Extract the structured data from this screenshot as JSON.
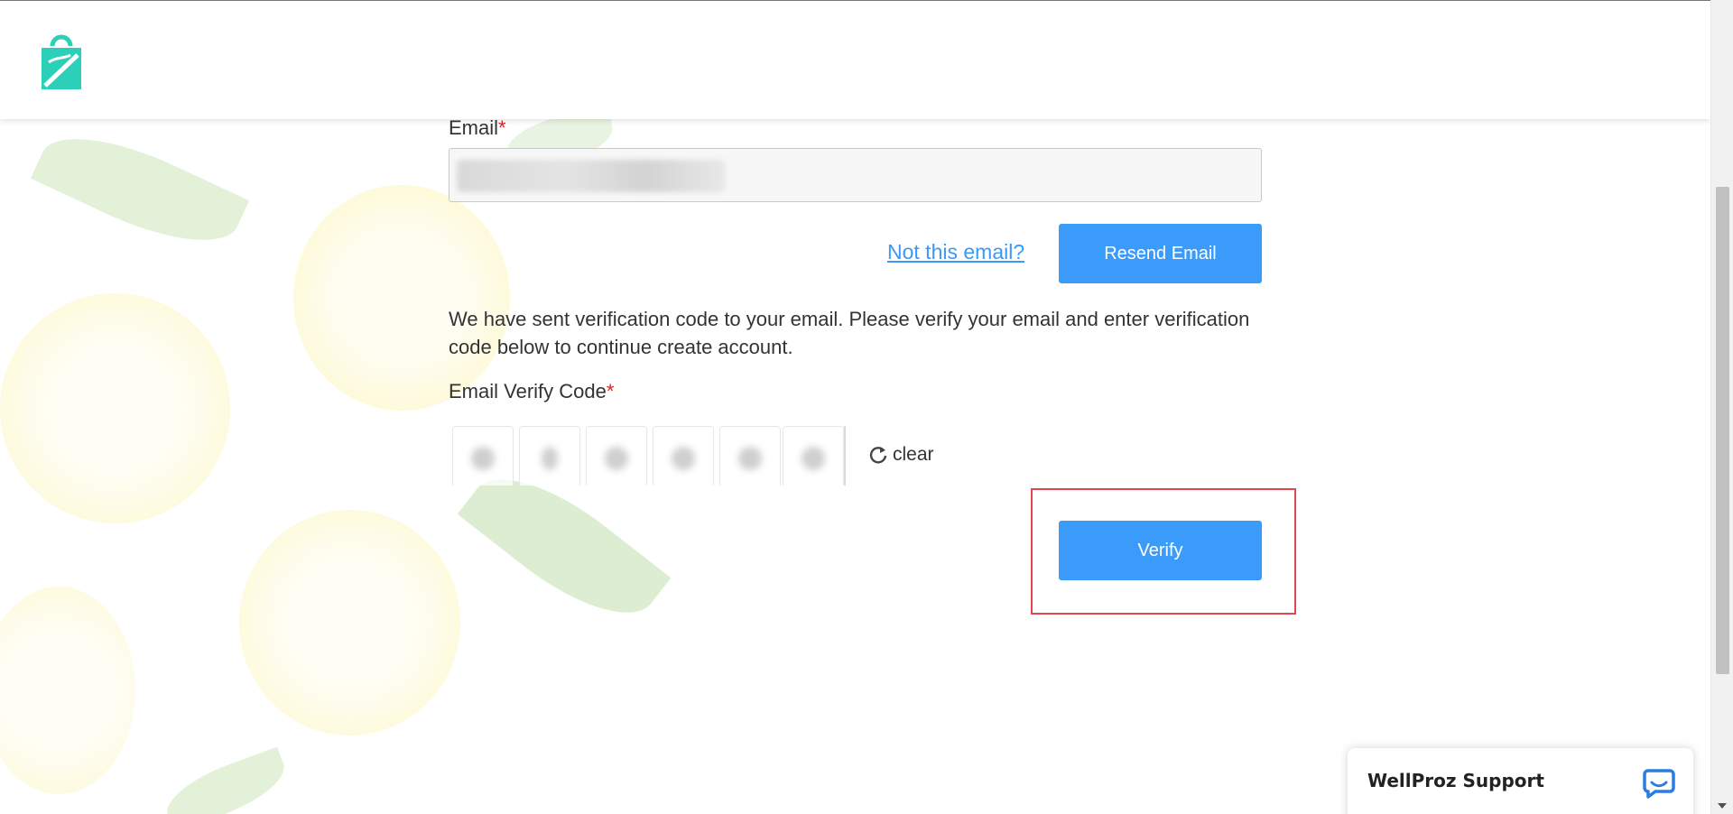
{
  "header": {
    "logo": "wellproz-bag-logo"
  },
  "form": {
    "email_label": "Email",
    "required_mark": "*",
    "email_value": "",
    "not_email_link": "Not this email?",
    "resend_button": "Resend Email",
    "message": "We have sent verification code to your email. Please verify your email and enter verification code below to continue create account.",
    "code_label": "Email Verify Code",
    "clear_button": "clear",
    "verify_button": "Verify"
  },
  "support": {
    "title": "WellProz Support",
    "icon": "chat-bubble-icon"
  },
  "colors": {
    "primary": "#3b9bfb",
    "link": "#3b98f5",
    "required": "#e02020",
    "highlight": "#e0474f",
    "logo": "#2ccfb8"
  }
}
